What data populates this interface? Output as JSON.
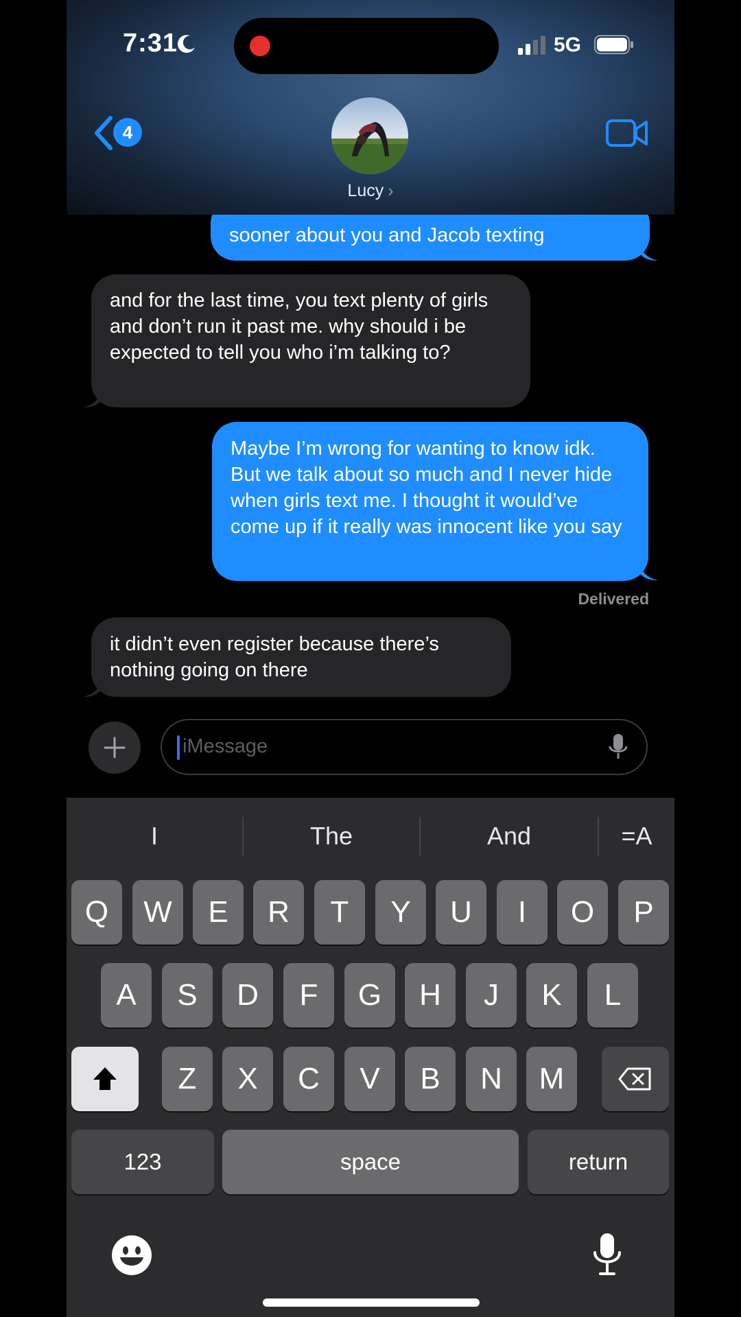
{
  "status": {
    "time": "7:31",
    "network": "5G"
  },
  "header": {
    "back_badge": "4",
    "contact_name": "Lucy",
    "name_chevron": "›"
  },
  "messages": [
    {
      "direction": "out",
      "text": "sooner about you and Jacob texting"
    },
    {
      "direction": "in",
      "text": "and for the last time, you text plenty of girls and don’t run it past me. why should i be expected to tell you who i’m talking to?"
    },
    {
      "direction": "out",
      "text": "Maybe I’m wrong for wanting to know idk. But we talk about so much and I never hide when girls text me. I thought it would’ve come up if it really was innocent like you say"
    },
    {
      "direction": "in",
      "text": "it didn’t even register because there’s nothing going on there"
    }
  ],
  "delivered_label": "Delivered",
  "compose": {
    "placeholder": "iMessage"
  },
  "keyboard": {
    "suggestions": [
      "I",
      "The",
      "And"
    ],
    "format_label": "=A",
    "row1": [
      "Q",
      "W",
      "E",
      "R",
      "T",
      "Y",
      "U",
      "I",
      "O",
      "P"
    ],
    "row2": [
      "A",
      "S",
      "D",
      "F",
      "G",
      "H",
      "J",
      "K",
      "L"
    ],
    "row3": [
      "Z",
      "X",
      "C",
      "V",
      "B",
      "N",
      "M"
    ],
    "numbers_label": "123",
    "space_label": "space",
    "return_label": "return"
  },
  "colors": {
    "outgoing": "#1f8dff",
    "incoming": "#262629",
    "accent": "#1f8dff",
    "record": "#e5302b"
  }
}
